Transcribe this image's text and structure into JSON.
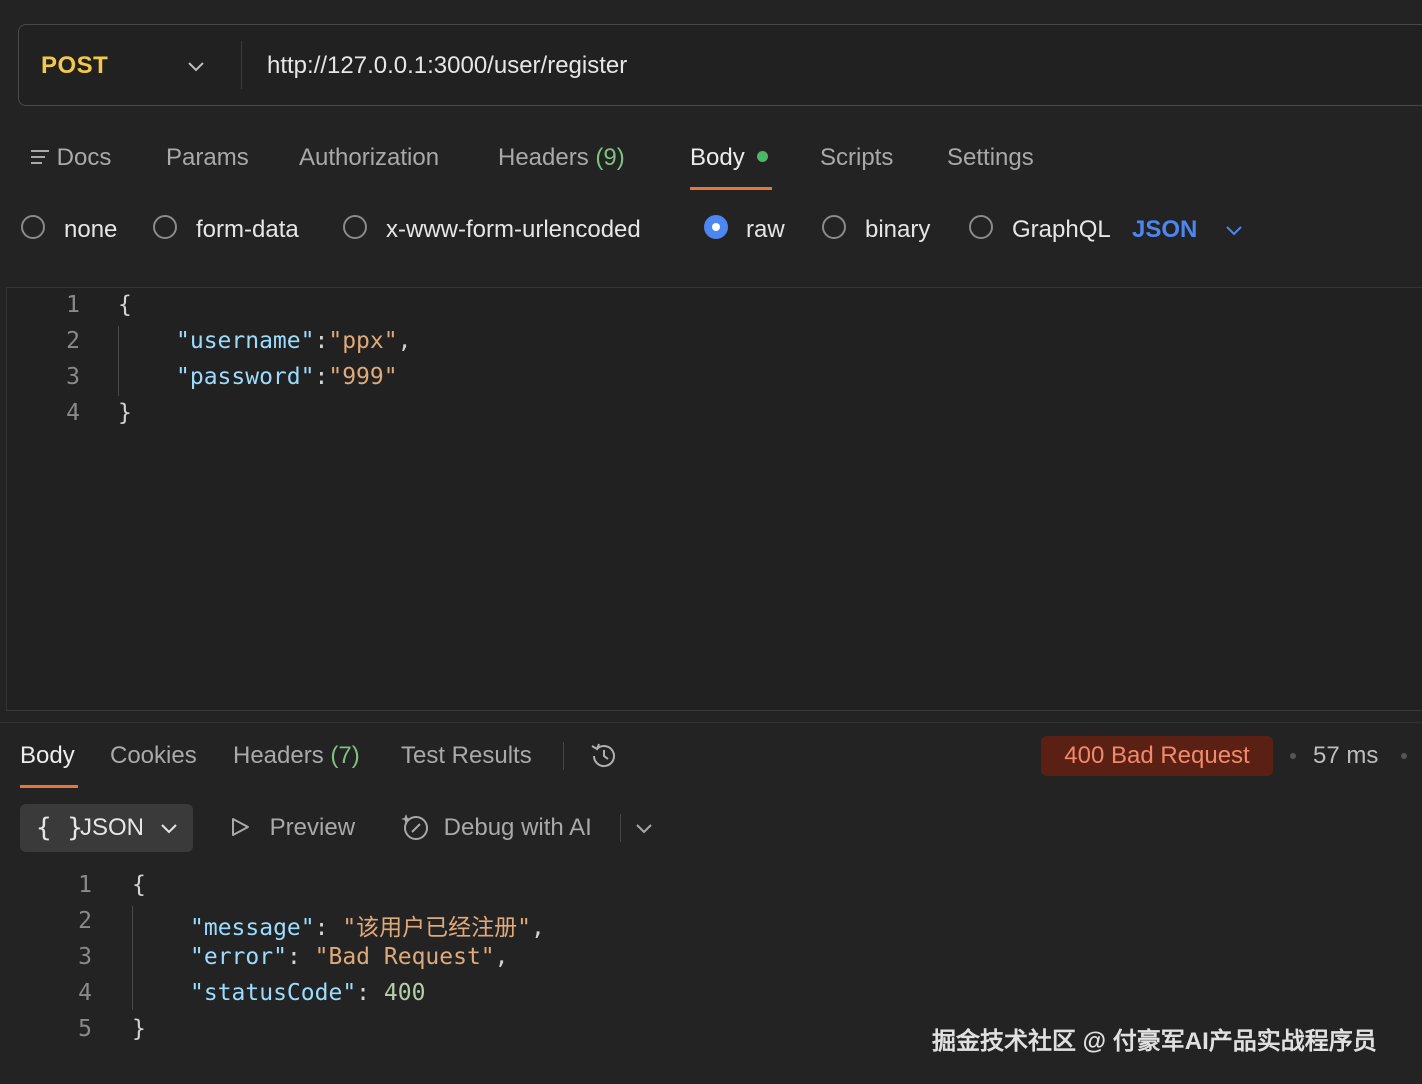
{
  "request": {
    "method": "POST",
    "url": "http://127.0.0.1:3000/user/register"
  },
  "request_tabs": {
    "docs": "Docs",
    "params": "Params",
    "authorization": "Authorization",
    "headers": "Headers",
    "headers_count": "(9)",
    "body": "Body",
    "scripts": "Scripts",
    "settings": "Settings"
  },
  "body_types": {
    "none": "none",
    "form_data": "form-data",
    "urlencoded": "x-www-form-urlencoded",
    "raw": "raw",
    "binary": "binary",
    "graphql": "GraphQL",
    "selected": "raw",
    "format": "JSON"
  },
  "request_body": {
    "line_numbers": [
      "1",
      "2",
      "3",
      "4"
    ],
    "open": "{",
    "close": "}",
    "key1": "\"username\"",
    "val1": "\"ppx\"",
    "key2": "\"password\"",
    "val2": "\"999\""
  },
  "response_tabs": {
    "body": "Body",
    "cookies": "Cookies",
    "headers": "Headers",
    "headers_count": "(7)",
    "test_results": "Test Results"
  },
  "response_status": {
    "status": "400 Bad Request",
    "time": "57 ms"
  },
  "response_toolbar": {
    "braces": "{ }",
    "format": "JSON",
    "preview": "Preview",
    "debug": "Debug with AI"
  },
  "response_body": {
    "line_numbers": [
      "1",
      "2",
      "3",
      "4",
      "5"
    ],
    "open": "{",
    "close": "}",
    "key1": "\"message\"",
    "val1": "\"该用户已经注册\"",
    "key2": "\"error\"",
    "val2": "\"Bad Request\"",
    "key3": "\"statusCode\"",
    "val3": "400"
  },
  "watermark": "掘金技术社区 @ 付豪军AI产品实战程序员",
  "colors": {
    "accent_orange": "#e8743b",
    "method_yellow": "#f2c94c",
    "selected_blue": "#4c86f0",
    "status_error_bg": "#5a2014",
    "status_error_text": "#f08a6a"
  }
}
